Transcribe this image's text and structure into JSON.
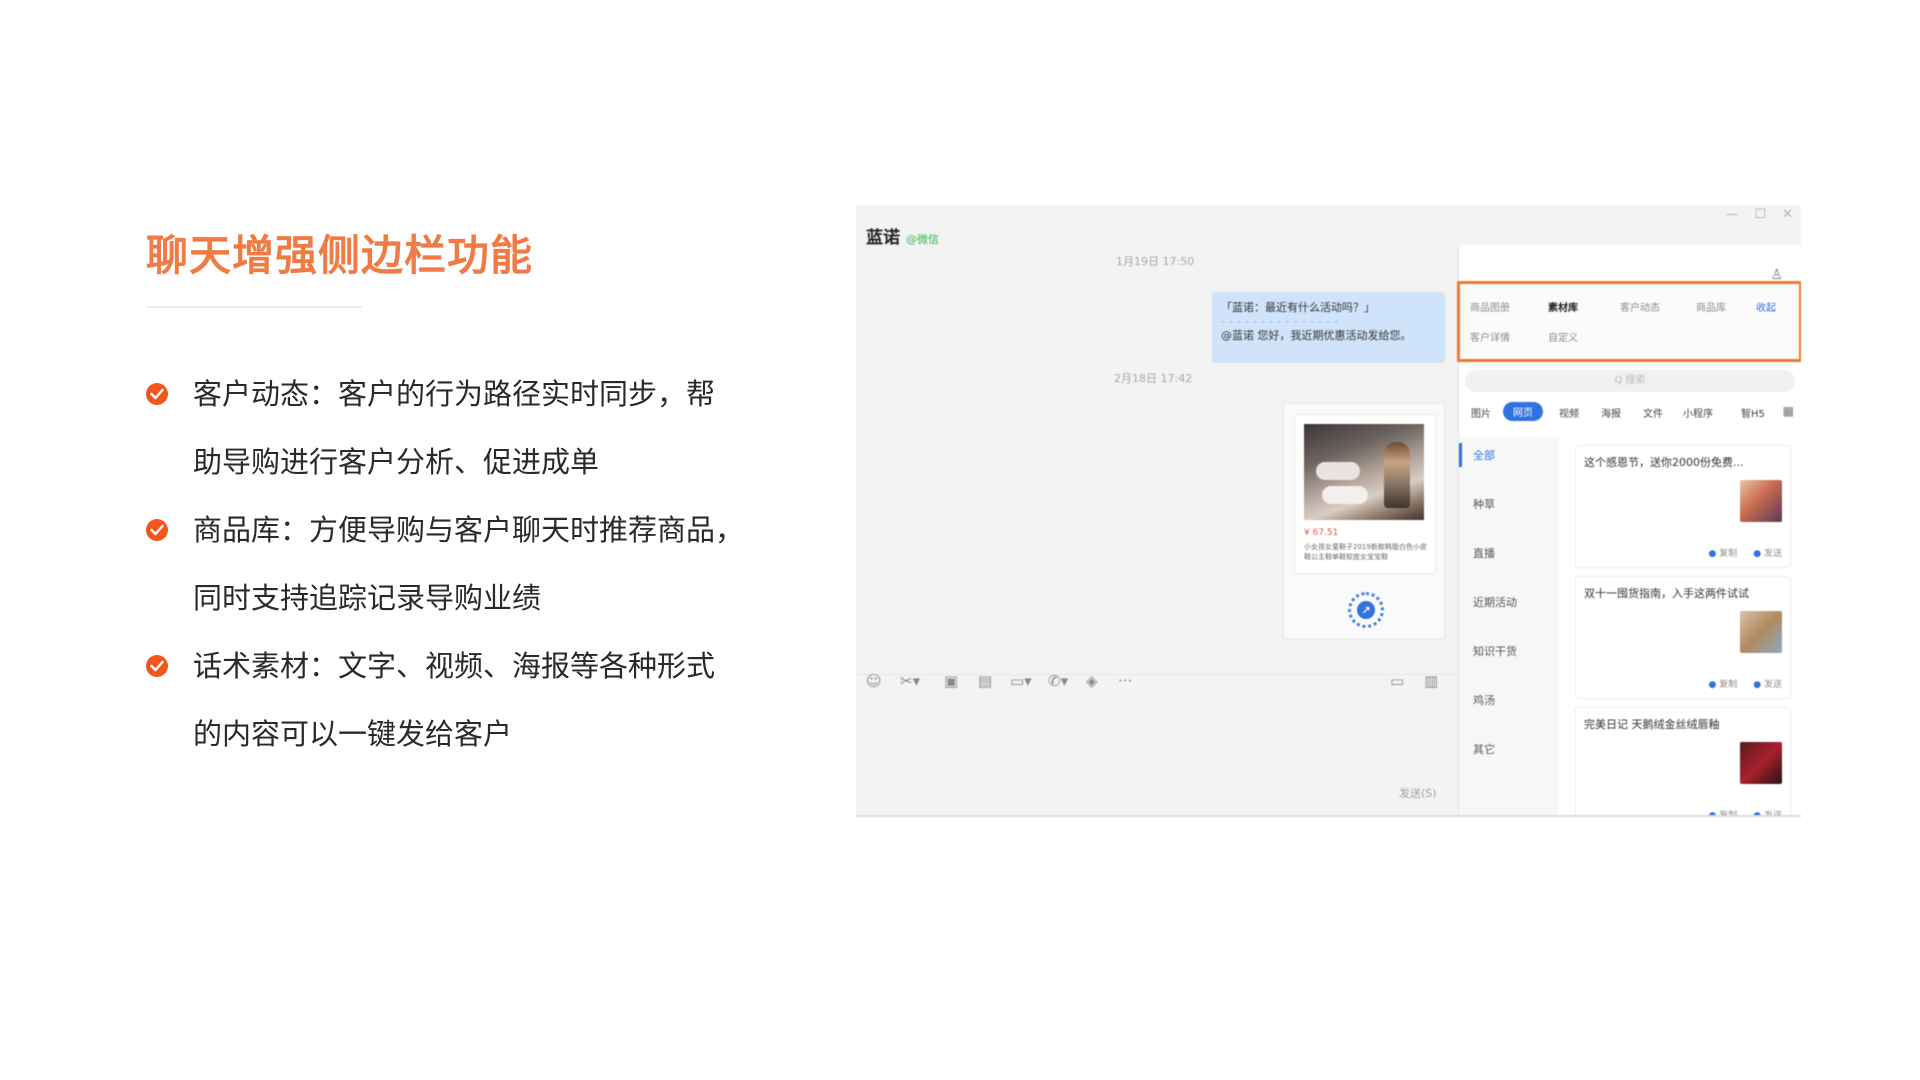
{
  "slide": {
    "heading": "聊天增强侧边栏功能",
    "bullets": [
      {
        "lines": [
          "客户动态：客户的行为路径实时同步，帮",
          "助导购进行客户分析、促进成单"
        ]
      },
      {
        "lines": [
          "商品库：方便导购与客户聊天时推荐商品，",
          "同时支持追踪记录导购业绩"
        ]
      },
      {
        "lines": [
          "话术素材：文字、视频、海报等各种形式",
          "的内容可以一键发给客户"
        ]
      }
    ]
  },
  "window": {
    "controls": [
      "—",
      "☐",
      "✕"
    ],
    "chat": {
      "title": "蓝诺",
      "tag": "@微信",
      "timestamp1": "1月19日 17:50",
      "message_line1": "「蓝诺：最近有什么活动吗？」",
      "message_sep": "- - - - - - - - - - - - - - -",
      "message_line2": "@蓝诺 您好，我近期优惠活动发给您。",
      "timestamp2": "2月18日 17:42",
      "product_price": "¥ 67.51",
      "product_desc": "小女孩女童鞋子2019新款韩版白色小皮鞋公主鞋单鞋软底女宝宝鞋",
      "send_label": "发送(S)"
    },
    "toolbar_icons": [
      "smile-icon",
      "scissors-icon",
      "image-icon",
      "screenshot-icon",
      "folder-icon",
      "phone-icon",
      "shield-icon",
      "more-icon"
    ],
    "sidebar": {
      "top_tabs_row1": [
        "商品图册",
        "素材库",
        "客户动态",
        "商品库",
        "收起"
      ],
      "top_tabs_row2": [
        "客户详情",
        "自定义"
      ],
      "active_tab": "素材库",
      "search_placeholder": "Q 搜索",
      "type_tabs": [
        "图片",
        "网页",
        "视频",
        "海报",
        "文件",
        "小程序",
        "智H5"
      ],
      "active_type": "网页",
      "categories": [
        "全部",
        "种草",
        "直播",
        "近期活动",
        "知识干货",
        "鸡汤",
        "其它"
      ],
      "active_category": "全部",
      "items": [
        {
          "title": "这个感恩节，送你2000份免费...",
          "copy": "复制",
          "send": "发送"
        },
        {
          "title": "双十一囤货指南，入手这两件试试",
          "copy": "复制",
          "send": "发送"
        },
        {
          "title": "完美日记 天鹅绒金丝绒唇釉",
          "copy": "复制",
          "send": "发送"
        }
      ]
    }
  },
  "colors": {
    "heading": "#f07b45",
    "check": "#f2561d",
    "highlight_border": "#f07b2c",
    "accent_blue": "#2f72e0",
    "bubble": "#cfe3fb"
  }
}
